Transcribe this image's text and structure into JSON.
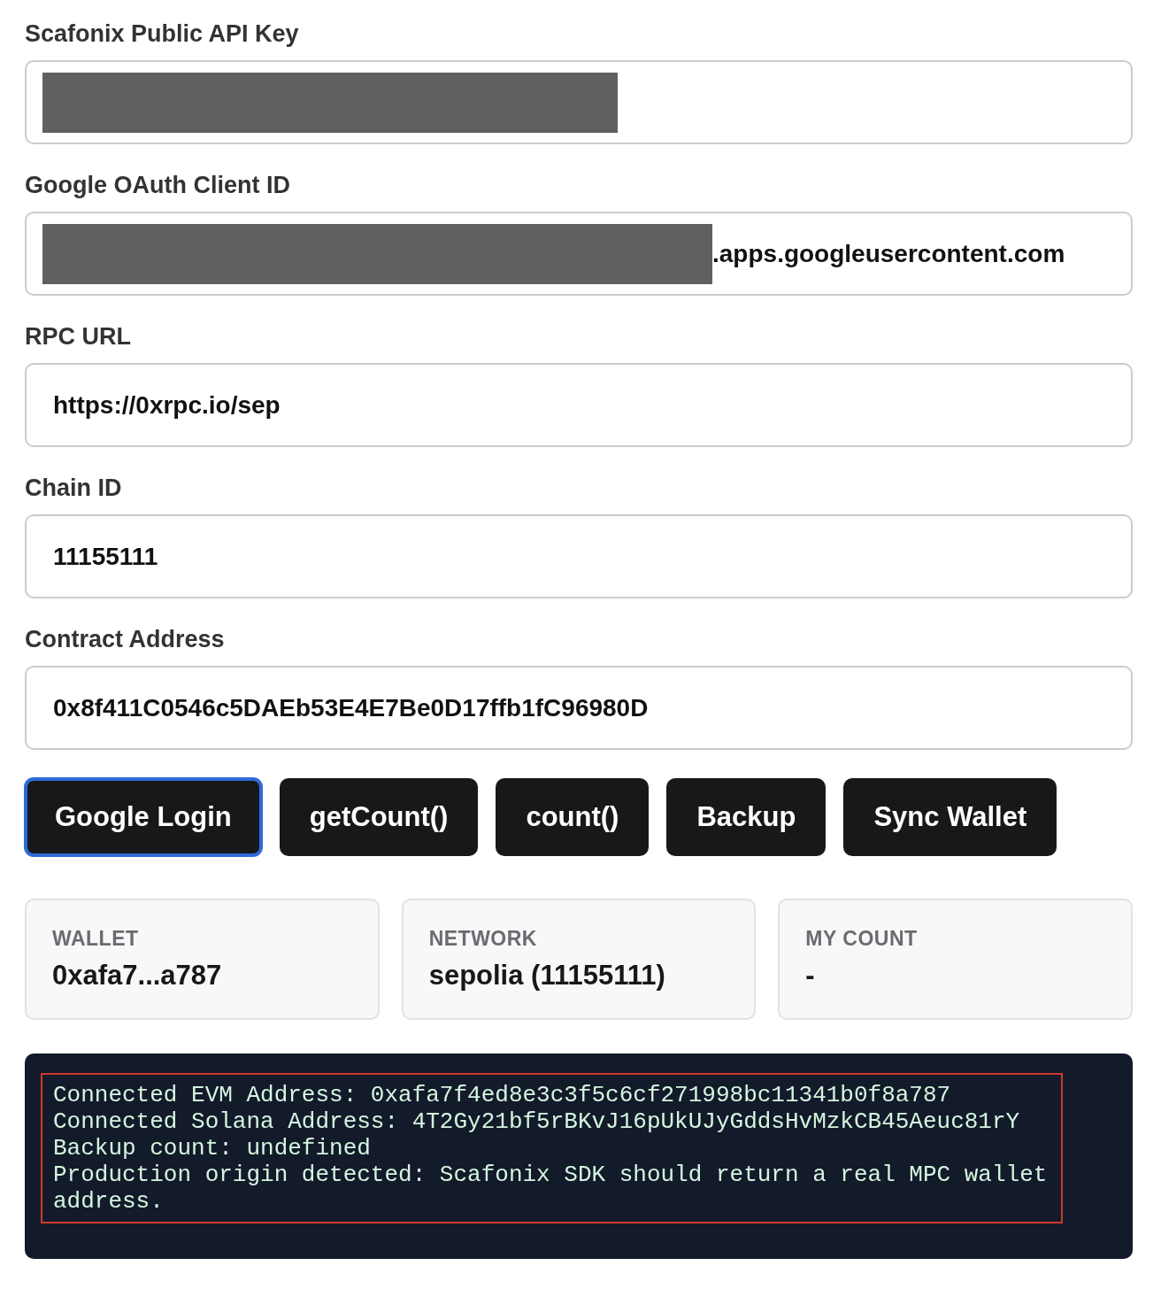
{
  "fields": [
    {
      "label": "Scafonix Public API Key",
      "redacted": true
    },
    {
      "label": "Google OAuth Client ID",
      "redacted": true,
      "value": ".apps.googleusercontent.com"
    },
    {
      "label": "RPC URL",
      "redacted": false,
      "value": "https://0xrpc.io/sep"
    },
    {
      "label": "Chain ID",
      "redacted": false,
      "value": "11155111"
    },
    {
      "label": "Contract Address",
      "redacted": false,
      "value": "0x8f411C0546c5DAEb53E4E7Be0D17ffb1fC96980D"
    }
  ],
  "buttons": [
    {
      "label": "Google Login",
      "focused": true
    },
    {
      "label": "getCount()",
      "focused": false
    },
    {
      "label": "count()",
      "focused": false
    },
    {
      "label": "Backup",
      "focused": false
    },
    {
      "label": "Sync Wallet",
      "focused": false
    }
  ],
  "stats": [
    {
      "label": "WALLET",
      "value": "0xafa7...a787"
    },
    {
      "label": "NETWORK",
      "value": "sepolia (11155111)"
    },
    {
      "label": "MY COUNT",
      "value": "-"
    }
  ],
  "log": {
    "lines": [
      "Connected EVM Address: 0xafa7f4ed8e3c3f5c6cf271998bc11341b0f8a787",
      "Connected Solana Address: 4T2Gy21bf5rBKvJ16pUkUJyGddsHvMzkCB45Aeuc81rY",
      "Backup count: undefined",
      "Production origin detected: Scafonix SDK should return a real MPC wallet address."
    ]
  }
}
